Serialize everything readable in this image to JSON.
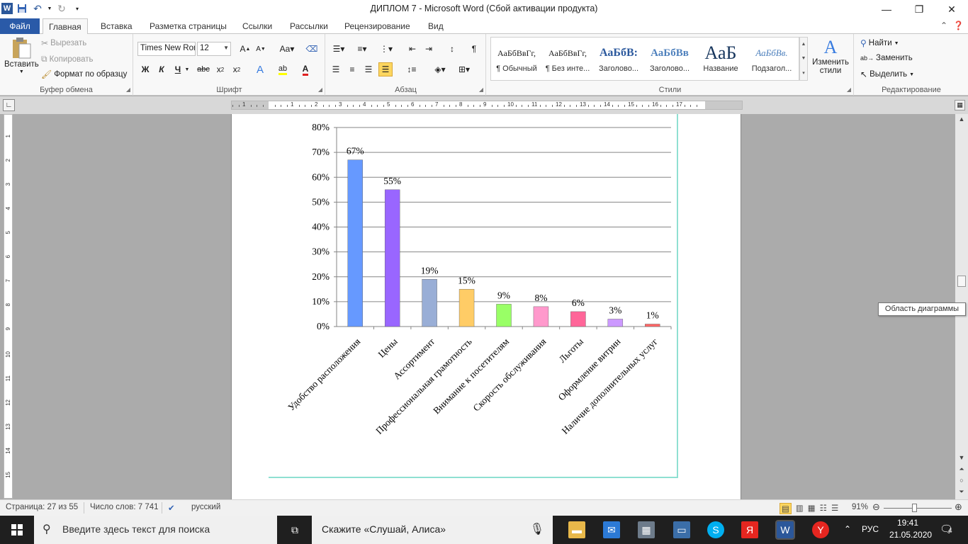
{
  "window": {
    "title": "ДИПЛОМ 7  -  Microsoft Word (Сбой активации продукта)",
    "logo": "W"
  },
  "tabs": [
    "Файл",
    "Главная",
    "Вставка",
    "Разметка страницы",
    "Ссылки",
    "Рассылки",
    "Рецензирование",
    "Вид"
  ],
  "ribbon": {
    "clipboard": {
      "paste": "Вставить",
      "cut": "Вырезать",
      "copy": "Копировать",
      "format_painter": "Формат по образцу",
      "label": "Буфер обмена"
    },
    "font": {
      "name": "Times New Roman",
      "size": "12",
      "bold": "Ж",
      "italic": "К",
      "underline": "Ч",
      "strike": "abc",
      "label": "Шрифт"
    },
    "paragraph": {
      "label": "Абзац"
    },
    "styles": {
      "label": "Стили",
      "change": "Изменить стили",
      "items": [
        {
          "sample": "АаБбВвГг,",
          "name": "¶ Обычный"
        },
        {
          "sample": "АаБбВвГг,",
          "name": "¶ Без инте..."
        },
        {
          "sample": "АаБбВ:",
          "name": "Заголово..."
        },
        {
          "sample": "АаБбВв",
          "name": "Заголово..."
        },
        {
          "sample": "АаБ",
          "name": "Название"
        },
        {
          "sample": "АаБбВв.",
          "name": "Подзагол..."
        }
      ]
    },
    "editing": {
      "label": "Редактирование",
      "find": "Найти",
      "replace": "Заменить",
      "select": "Выделить"
    }
  },
  "tooltip": "Область диаграммы",
  "chart_data": {
    "type": "bar",
    "categories": [
      "Удобство расположения",
      "Цены",
      "Ассортимент",
      "Профессиональная грамотность",
      "Внимание к посетителям",
      "Скорость обслуживания",
      "Льготы",
      "Оформление витрин",
      "Наличие дополнительных услуг"
    ],
    "values": [
      67,
      55,
      19,
      15,
      9,
      8,
      6,
      3,
      1
    ],
    "value_labels": [
      "67%",
      "55%",
      "19%",
      "15%",
      "9%",
      "8%",
      "6%",
      "3%",
      "1%"
    ],
    "colors": [
      "#6699ff",
      "#9966ff",
      "#99aed6",
      "#ffcc66",
      "#99ff66",
      "#ff99cc",
      "#ff6699",
      "#cc99ff",
      "#ff6666"
    ],
    "ylim": [
      0,
      80
    ],
    "yticks": [
      0,
      10,
      20,
      30,
      40,
      50,
      60,
      70,
      80
    ],
    "ytick_labels": [
      "0%",
      "10%",
      "20%",
      "30%",
      "40%",
      "50%",
      "60%",
      "70%",
      "80%"
    ],
    "grid": true,
    "legend": "none"
  },
  "status": {
    "page": "Страница: 27 из 55",
    "words": "Число слов: 7 741",
    "language": "русский",
    "zoom": "91%"
  },
  "taskbar": {
    "search_placeholder": "Введите здесь текст для поиска",
    "alice": "Скажите «Слушай, Алиса»",
    "lang": "РУС",
    "time": "19:41",
    "date": "21.05.2020",
    "notifications": "4"
  }
}
